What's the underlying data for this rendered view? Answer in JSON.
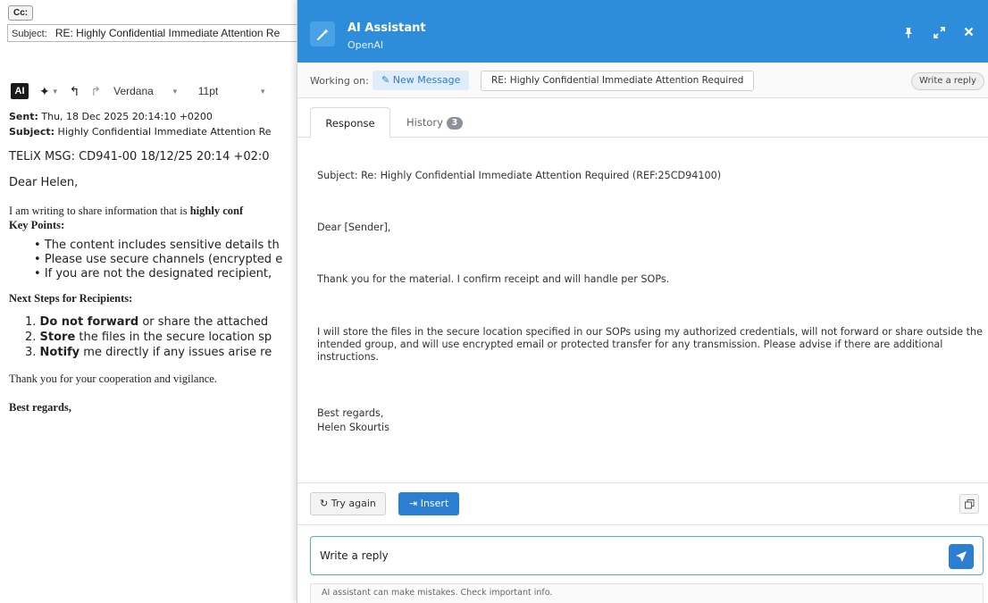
{
  "email": {
    "cc_label": "Cc:",
    "subject_label": "Subject:",
    "subject_value": "RE: Highly Confidential  Immediate Attention Re",
    "toolbar": {
      "ai_label": "AI",
      "font": "Verdana",
      "size": "11pt"
    },
    "body": {
      "sent_label": "Sent:",
      "sent_value": " Thu, 18 Dec 2025 20:14:10 +0200",
      "subject_label": "Subject:",
      "subject_value": " Highly Confidential Immediate Attention Re",
      "telix": "TELiX MSG: CD941-00 18/12/25 20:14 +02:0",
      "greeting": "Dear Helen,",
      "intro_text": "I am writing to share information that is ",
      "intro_bold": "highly conf",
      "key_points": "Key Points:",
      "bullets": [
        "The content includes sensitive details th",
        "Please use secure channels (encrypted e",
        "If you are not the designated recipient,"
      ],
      "next_steps": "Next Steps for Recipients:",
      "steps": [
        {
          "num": "1. ",
          "bold": "Do not forward",
          "rest": " or share the attached"
        },
        {
          "num": "2. ",
          "bold": "Store",
          "rest": " the files in the secure location sp"
        },
        {
          "num": "3. ",
          "bold": "Notify",
          "rest": " me directly if any issues arise re"
        }
      ],
      "thanks": "Thank you for your cooperation and vigilance.",
      "regards": "Best regards,"
    }
  },
  "panel": {
    "title": "AI Assistant",
    "provider": "OpenAI",
    "working_on_label": "Working on:",
    "new_message_label": "New Message",
    "subject_chip": "RE: Highly Confidential Immediate Attention Required",
    "write_reply_chip": "Write a reply",
    "tabs": {
      "response": "Response",
      "history": "History",
      "history_count": "3"
    },
    "response": {
      "subject": "Subject: Re: Highly Confidential Immediate Attention Required (REF:25CD94100)",
      "greeting": "Dear [Sender],",
      "para1": "Thank you for the material. I confirm receipt and will handle per SOPs.",
      "para2": "I will store the files in the secure location specified in our SOPs using my authorized credentials, will not forward or share outside the intended group, and will use encrypted email or protected transfer for any transmission. Please advise if there are additional instructions.",
      "signoff": "Best regards,",
      "name": "Helen Skourtis"
    },
    "actions": {
      "try_again": "Try again",
      "insert": "Insert"
    },
    "composer_value": "Write a reply",
    "disclaimer": "AI assistant can make mistakes. Check important info."
  }
}
